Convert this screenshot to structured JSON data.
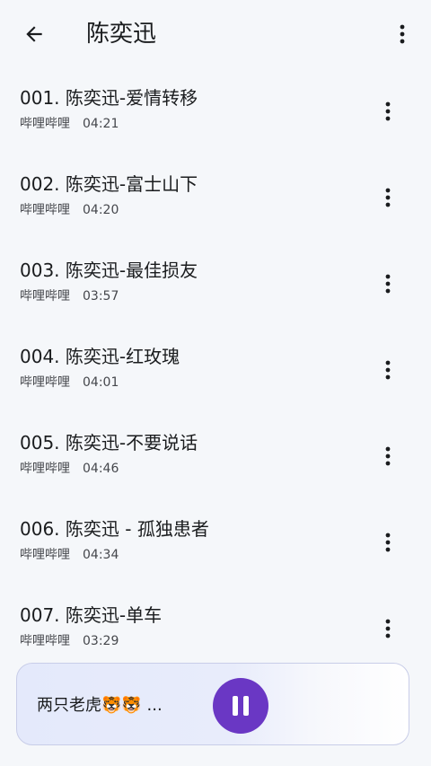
{
  "appbar": {
    "title": "陈奕迅",
    "back_icon": "arrow-left-icon",
    "more_icon": "more-vert-icon"
  },
  "songs": [
    {
      "title": "001. 陈奕迅-爱情转移",
      "artist": "哔哩哔哩",
      "duration": "04:21"
    },
    {
      "title": "002. 陈奕迅-富士山下",
      "artist": "哔哩哔哩",
      "duration": "04:20"
    },
    {
      "title": "003. 陈奕迅-最佳损友",
      "artist": "哔哩哔哩",
      "duration": "03:57"
    },
    {
      "title": "004. 陈奕迅-红玫瑰",
      "artist": "哔哩哔哩",
      "duration": "04:01"
    },
    {
      "title": "005. 陈奕迅-不要说话",
      "artist": "哔哩哔哩",
      "duration": "04:46"
    },
    {
      "title": "006. 陈奕迅 - 孤独患者",
      "artist": "哔哩哔哩",
      "duration": "04:34"
    },
    {
      "title": "007. 陈奕迅-单车",
      "artist": "哔哩哔哩",
      "duration": "03:29"
    }
  ],
  "player": {
    "now_playing": "两只老虎🐯🐯 ...",
    "state_icon": "pause-icon",
    "accent_color": "#6a37c4"
  }
}
